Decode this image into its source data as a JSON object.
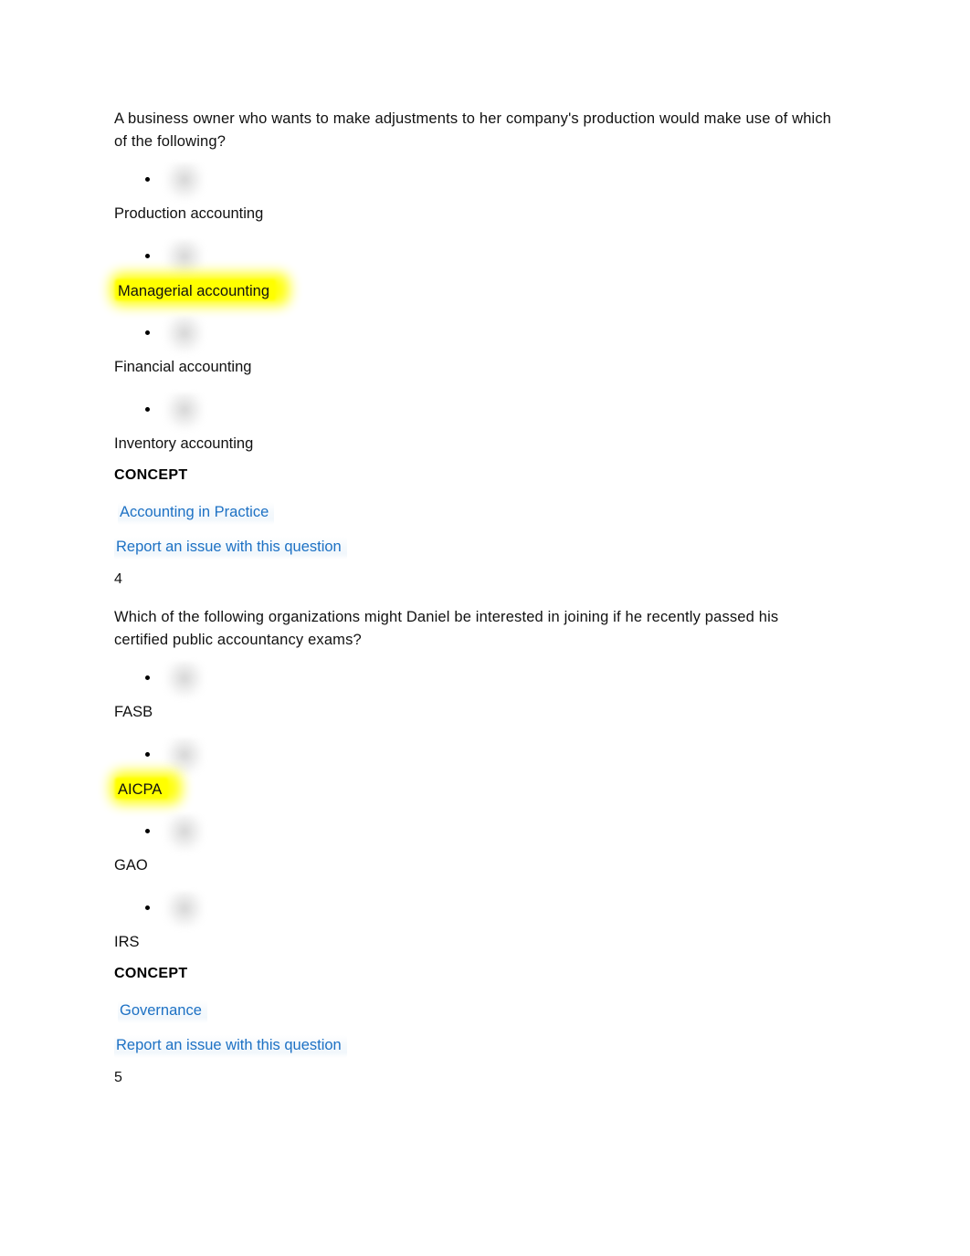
{
  "document": {
    "background_color": "#ffffff",
    "text_color": "#111111",
    "link_color": "#1d71c4",
    "highlight_color": "#ffff00"
  },
  "questions": [
    {
      "prompt": "A business owner who wants to make adjustments to her company's production would make use of which of the following?",
      "options": [
        {
          "label": "Production accounting",
          "highlighted": false
        },
        {
          "label": "Managerial accounting",
          "highlighted": true
        },
        {
          "label": "Financial accounting",
          "highlighted": false
        },
        {
          "label": "Inventory accounting",
          "highlighted": false
        }
      ],
      "concept_heading": "CONCEPT",
      "concept_link": "Accounting in Practice",
      "report_link": "Report an issue with this question",
      "next_number": "4"
    },
    {
      "prompt": "Which of the following organizations might Daniel be interested in joining if he recently passed his certified public accountancy exams?",
      "options": [
        {
          "label": "FASB",
          "highlighted": false
        },
        {
          "label": "AICPA",
          "highlighted": true
        },
        {
          "label": "GAO",
          "highlighted": false
        },
        {
          "label": "IRS",
          "highlighted": false
        }
      ],
      "concept_heading": "CONCEPT",
      "concept_link": "Governance",
      "report_link": "Report an issue with this question",
      "next_number": "5"
    }
  ]
}
